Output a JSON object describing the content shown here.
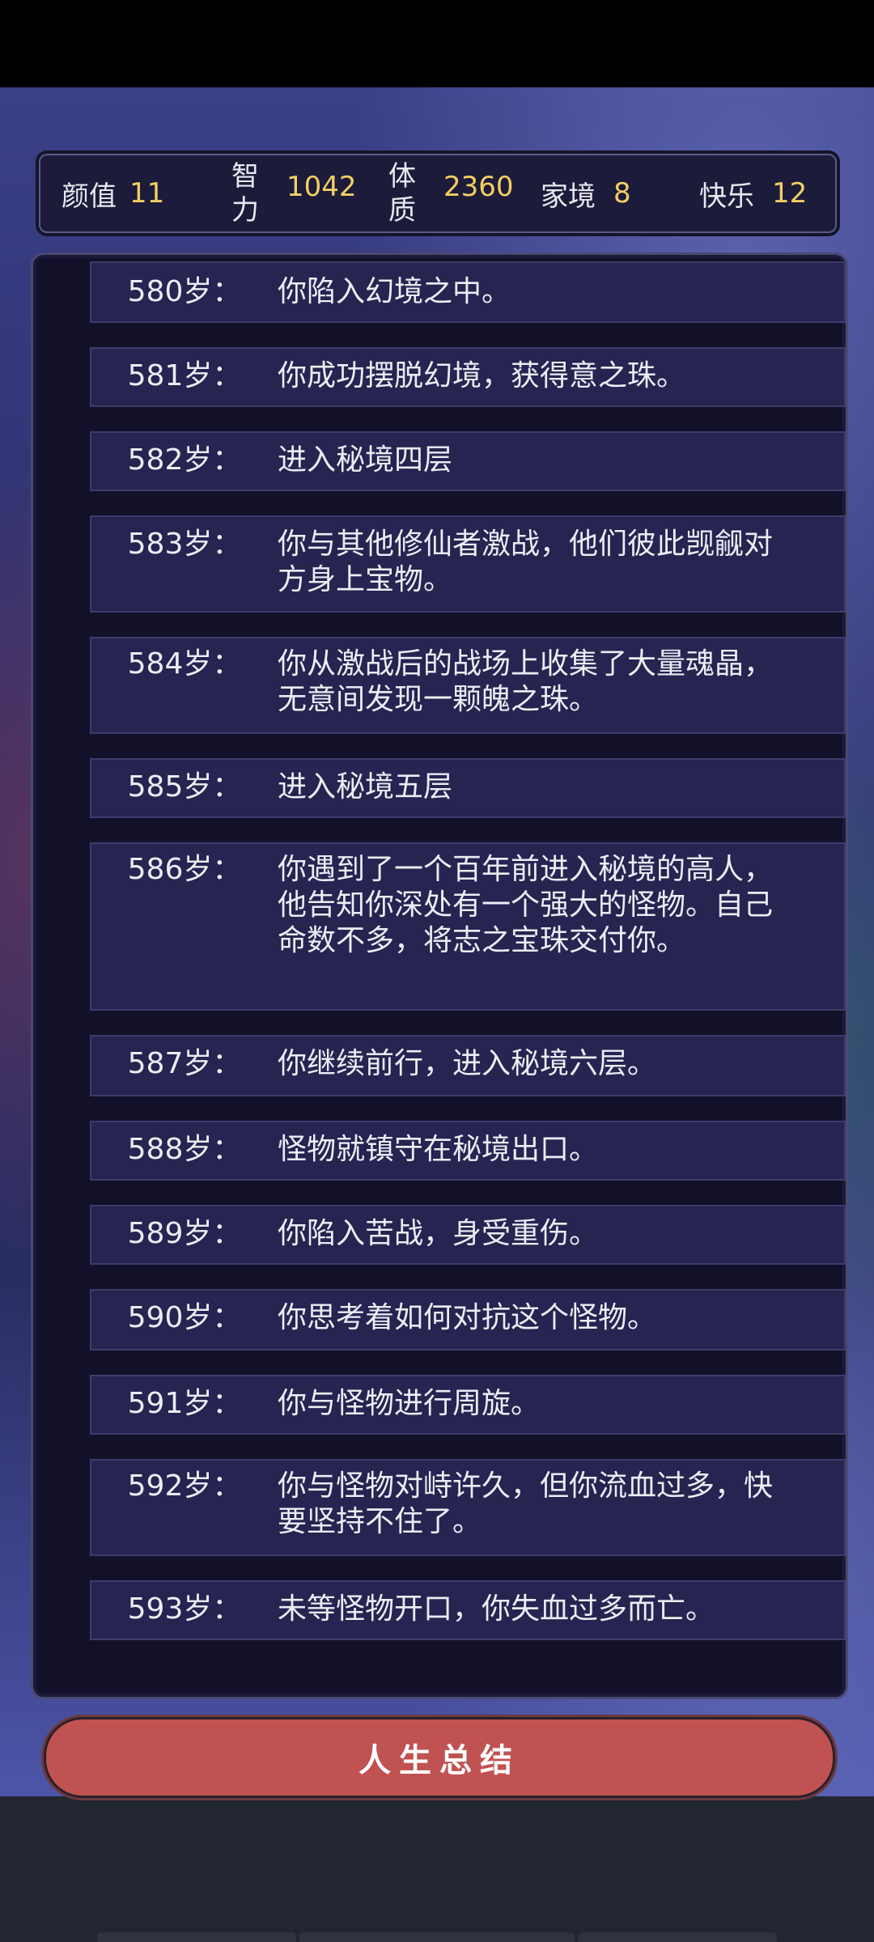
{
  "stats": [
    {
      "label": "颜值",
      "value": "11"
    },
    {
      "label": "智力",
      "value": "1042"
    },
    {
      "label": "体质",
      "value": "2360"
    },
    {
      "label": "家境",
      "value": "8"
    },
    {
      "label": "快乐",
      "value": "12"
    }
  ],
  "log": [
    {
      "age": "580岁：",
      "text": "你陷入幻境之中。"
    },
    {
      "age": "581岁：",
      "text": "你成功摆脱幻境，获得意之珠。"
    },
    {
      "age": "582岁：",
      "text": "进入秘境四层"
    },
    {
      "age": "583岁：",
      "text": "你与其他修仙者激战，他们彼此觊觎对方身上宝物。"
    },
    {
      "age": "584岁：",
      "text": "你从激战后的战场上收集了大量魂晶，无意间发现一颗魄之珠。"
    },
    {
      "age": "585岁：",
      "text": "进入秘境五层"
    },
    {
      "age": "586岁：",
      "text": "你遇到了一个百年前进入秘境的高人，他告知你深处有一个强大的怪物。自己命数不多，将志之宝珠交付你。"
    },
    {
      "age": "587岁：",
      "text": "你继续前行，进入秘境六层。"
    },
    {
      "age": "588岁：",
      "text": "怪物就镇守在秘境出口。"
    },
    {
      "age": "589岁：",
      "text": "你陷入苦战，身受重伤。"
    },
    {
      "age": "590岁：",
      "text": "你思考着如何对抗这个怪物。"
    },
    {
      "age": "591岁：",
      "text": "你与怪物进行周旋。"
    },
    {
      "age": "592岁：",
      "text": "你与怪物对峙许久，但你流血过多，快要坚持不住了。"
    },
    {
      "age": "593岁：",
      "text": "未等怪物开口，你失血过多而亡。"
    }
  ],
  "summary_button": "人生总结"
}
